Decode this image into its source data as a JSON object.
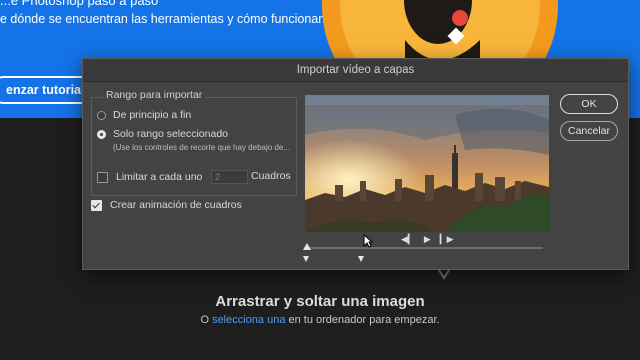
{
  "background": {
    "hero_line1": "...e Photoshop paso a paso",
    "hero_line2": "e dónde se encuentran las herramientas y cómo funcionan.",
    "hero_button": "enzar tutorial",
    "drop_title": "Arrastrar y soltar una imagen",
    "drop_prefix": "O ",
    "drop_link": "selecciona una",
    "drop_suffix": " en tu ordenador para empezar."
  },
  "dialog": {
    "title": "Importar vídeo a capas",
    "range_legend": "Rango para importar",
    "option_all": "De principio a fin",
    "option_selected": "Solo rango seleccionado",
    "selected_option": "option_selected",
    "hint": "(Use los controles de recorte que hay debajo de...",
    "limit_label": "Limitar a cada uno",
    "limit_value": "2",
    "limit_unit": "Cuadros",
    "limit_checked": false,
    "frame_anim_label": "Crear animación de cuadros",
    "frame_anim_checked": true,
    "ok": "OK",
    "cancel": "Cancelar",
    "playback": {
      "prev": "◀▎",
      "play": "▶",
      "next": "▎▶"
    }
  },
  "icons": [
    "radio-icon",
    "checkbox-icon",
    "play-icon",
    "prev-frame-icon",
    "next-frame-icon",
    "cursor-icon",
    "down-arrow-icon"
  ],
  "colors": {
    "accent": "#1473e6",
    "link": "#4b9cf5",
    "dialog_bg": "#434343"
  }
}
